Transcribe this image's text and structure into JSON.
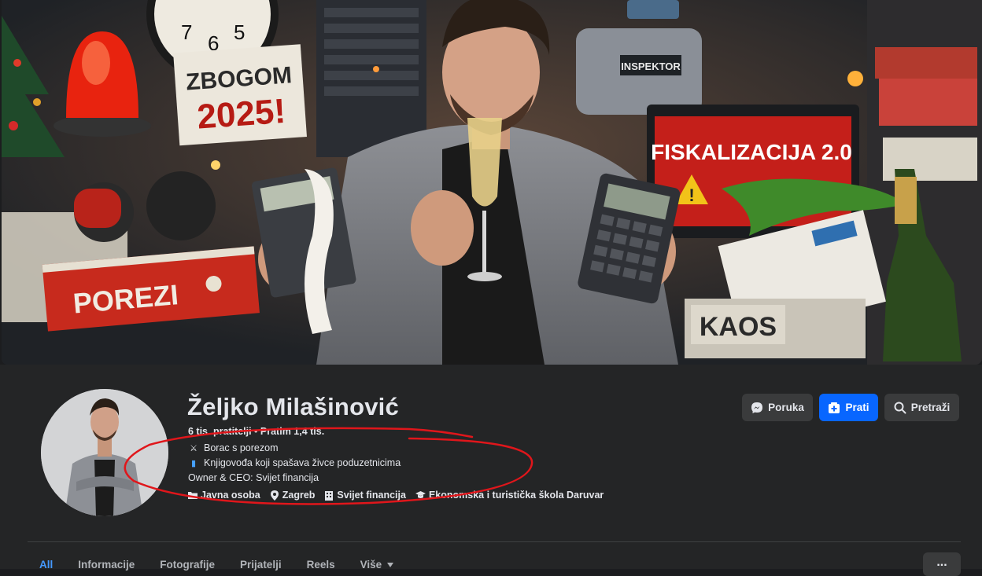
{
  "cover": {
    "sign_line1": "ZBOGOM",
    "sign_line2": "2025!",
    "binder_label": "POREZI",
    "screen_label": "FISKALIZACIJA 2.0",
    "robot_label": "INSPEKTOR",
    "drawer_label": "KAOS",
    "clock_numbers": [
      "7",
      "6",
      "5"
    ]
  },
  "profile": {
    "name": "Željko Milašinović",
    "stats": "6 tis. pratitelji • Pratim 1,4 tis.",
    "bio": [
      {
        "emoji": "⚔",
        "text": "Borac s porezom"
      },
      {
        "emoji": "▮",
        "text": "Knjigovođa koji spašava živce poduzetnicima"
      },
      {
        "emoji": "",
        "text": "Owner & CEO: Svijet financija"
      }
    ],
    "details": [
      {
        "icon": "folder-icon",
        "text": "Javna osoba"
      },
      {
        "icon": "location-pin-icon",
        "text": "Zagreb"
      },
      {
        "icon": "building-icon",
        "text": "Svijet financija"
      },
      {
        "icon": "graduation-cap-icon",
        "text": "Ekonomska i turistička škola Daruvar"
      }
    ]
  },
  "actions": {
    "message": "Poruka",
    "follow": "Prati",
    "search": "Pretraži"
  },
  "tabs": [
    {
      "label": "All",
      "active": true
    },
    {
      "label": "Informacije"
    },
    {
      "label": "Fotografije"
    },
    {
      "label": "Prijatelji"
    },
    {
      "label": "Reels"
    },
    {
      "label": "Više"
    }
  ],
  "more_label": "...",
  "colors": {
    "accent": "#0866ff",
    "annotation": "#e0161b",
    "background": "#242526"
  }
}
